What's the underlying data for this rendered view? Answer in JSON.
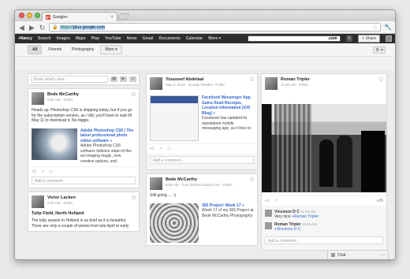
{
  "browser": {
    "tab_title": "Google+",
    "favicon_text": "g+",
    "url_prefix": "https://",
    "url_host": "plus.google.com"
  },
  "gbar": {
    "items": [
      "+Nancy",
      "Search",
      "Images",
      "Maps",
      "Play",
      "YouTube",
      "News",
      "Gmail",
      "Documents",
      "Calendar",
      "More ▾"
    ],
    "search_value": ".com",
    "notification_count": "0",
    "share_label": "+ Share"
  },
  "filters": {
    "chips": [
      "All",
      "Friends",
      "Photography",
      "More ▾"
    ]
  },
  "share": {
    "placeholder": "Share what's new..."
  },
  "posts": {
    "bede1": {
      "author": "Bede McCarthy",
      "meta": "8:00 AM  -  Public",
      "text": "Heads up: Photoshop CS6 is shipping today, but if you go for the subscription version, as I did, you'll have to wait till May 11 to download it. No biggie.",
      "link_title": "Adobe Photoshop CS6 | The latest professional photo editor software »",
      "link_desc": "Adobe Photoshop CS6 software delivers state-of-the-art imaging magic, new creative options, and",
      "plus_count": "+1",
      "comment_placeholder": "Add a comment..."
    },
    "victor": {
      "author": "Victor Lacken",
      "meta": "8:00 AM  -  Public",
      "title": "Tulip Field, North Holland",
      "text": "The tulip season in Holland is as brief as it is beautiful. There are only a couple of weeks from late April to early"
    },
    "yousseef": {
      "author": "Yousseef Abdelaal",
      "meta": "May 3, 2012  -  Google Reader  -  Public",
      "link_title": "Facebook Messenger App Gains Read Receipts, Location Information [iOS Blog] »",
      "link_desc": "Facebook has updated its standalone mobile messaging app, as it tries to",
      "plus_count": "+1",
      "comment_placeholder": "Add a comment..."
    },
    "bede2": {
      "author": "Bede McCarthy",
      "meta": "8:00 AM  -  from bedemccarthy.com  -  Public",
      "text": "Still going ... :-)",
      "link_title": "365 Project: Week 17 »",
      "link_desc": "Week 17 of my 365 Project at Bede McCarthy Photography"
    },
    "roman": {
      "author": "Roman Tripler",
      "meta": "11:39 AM  -  Public",
      "plus_count": "+1",
      "share_count": "+26",
      "comments": [
        {
          "name": "Vincenzo D C",
          "time": "11:43 AM",
          "text_prefix": "Very nice ",
          "mention": "+Roman Tripler"
        },
        {
          "name": "Roman Tripler",
          "time": "11:56 AM",
          "text_prefix": "",
          "mention": "+Vincenzo D C"
        }
      ],
      "comment_placeholder": "Add a comment..."
    }
  },
  "chat": {
    "label": "Chat"
  },
  "icons": {
    "back": "◀",
    "forward": "▶",
    "reload": "↻",
    "star": "☆",
    "wrench": "🔧",
    "gear": "⚙"
  },
  "colors": {
    "gbar_bg": "#2d2d2d",
    "link": "#3366cc",
    "url_green": "#1a7a1a"
  }
}
